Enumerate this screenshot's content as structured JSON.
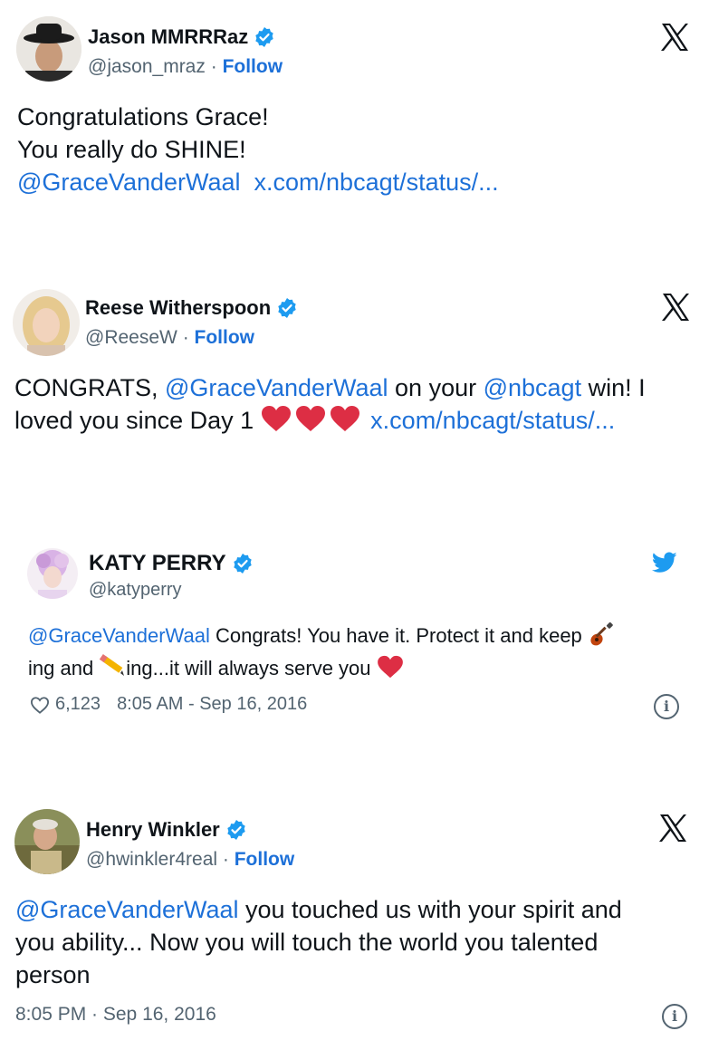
{
  "tweets": [
    {
      "name": "Jason MMRRRaz",
      "handle": "@jason_mraz",
      "sep": "·",
      "follow": "Follow",
      "line1": "Congratulations Grace!",
      "line2": "You really do SHINE!",
      "mention": "@GraceVanderWaal",
      "url": "x.com/nbcagt/status/..."
    },
    {
      "name": "Reese Witherspoon",
      "handle": "@ReeseW",
      "sep": "·",
      "follow": "Follow",
      "text_a": "CONGRATS, ",
      "mention1": "@GraceVanderWaal",
      "text_b": " on your ",
      "mention2": "@nbcagt",
      "text_c": " win! I",
      "text_d": "loved you since Day 1 ",
      "url": "x.com/nbcagt/status/..."
    },
    {
      "name": "KATY PERRY",
      "handle": "@katyperry",
      "mention": "@GraceVanderWaal",
      "text_a": " Congrats! You have it. Protect it and keep ",
      "text_b": "ing and ",
      "text_c": "ing...it will always serve you ",
      "likes": "6,123",
      "timestamp": "8:05 AM - Sep 16, 2016"
    },
    {
      "name": "Henry Winkler",
      "handle": "@hwinkler4real",
      "sep": "·",
      "follow": "Follow",
      "mention": "@GraceVanderWaal",
      "text_a": " you touched us with your spirit and",
      "text_b": "you ability... Now you will touch the world you talented",
      "text_c": "person",
      "timestamp": "8:05 PM · Sep 16, 2016"
    }
  ],
  "colors": {
    "link": "#1d70d8",
    "verified": "#1d9bf0",
    "twitter_bird": "#1d9bf0",
    "heart": "#e0245e",
    "meta": "#536471"
  },
  "icons": [
    "x-logo-icon",
    "verified-badge-icon",
    "twitter-bird-icon",
    "heart-outline-icon",
    "info-icon",
    "guitar-icon",
    "pencil-icon",
    "red-heart-icon"
  ]
}
